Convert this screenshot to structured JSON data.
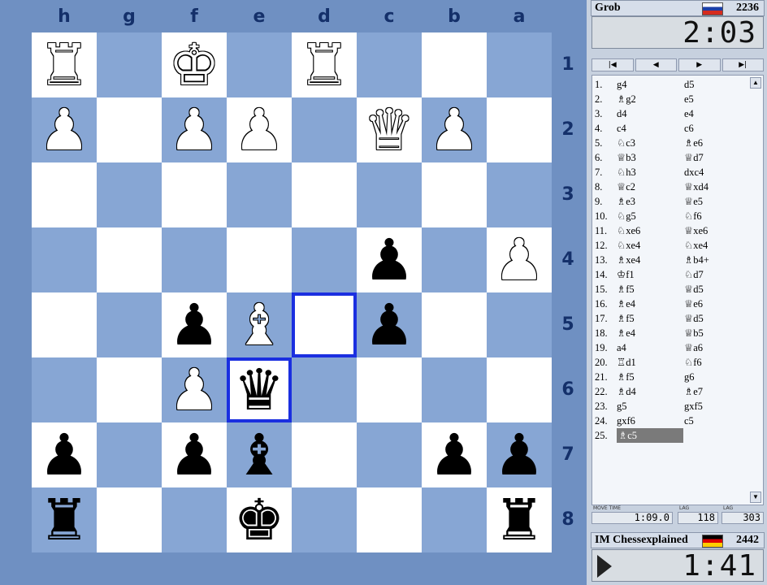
{
  "board": {
    "files": [
      "h",
      "g",
      "f",
      "e",
      "d",
      "c",
      "b",
      "a"
    ],
    "ranks": [
      "1",
      "2",
      "3",
      "4",
      "5",
      "6",
      "7",
      "8"
    ],
    "highlighted": [
      "4-4",
      "5-3"
    ],
    "pieces": [
      {
        "r": 0,
        "c": 0,
        "glyph": "♜",
        "color": "w",
        "name": "white-rook-icon"
      },
      {
        "r": 0,
        "c": 2,
        "glyph": "♚",
        "color": "w",
        "name": "white-king-icon"
      },
      {
        "r": 0,
        "c": 4,
        "glyph": "♜",
        "color": "w",
        "name": "white-rook-icon"
      },
      {
        "r": 1,
        "c": 0,
        "glyph": "♟",
        "color": "w",
        "name": "white-pawn-icon"
      },
      {
        "r": 1,
        "c": 2,
        "glyph": "♟",
        "color": "w",
        "name": "white-pawn-icon"
      },
      {
        "r": 1,
        "c": 3,
        "glyph": "♟",
        "color": "w",
        "name": "white-pawn-icon"
      },
      {
        "r": 1,
        "c": 5,
        "glyph": "♛",
        "color": "w",
        "name": "white-queen-icon"
      },
      {
        "r": 1,
        "c": 6,
        "glyph": "♟",
        "color": "w",
        "name": "white-pawn-icon"
      },
      {
        "r": 3,
        "c": 5,
        "glyph": "♟",
        "color": "b",
        "name": "black-pawn-icon"
      },
      {
        "r": 3,
        "c": 7,
        "glyph": "♟",
        "color": "w",
        "name": "white-pawn-icon"
      },
      {
        "r": 4,
        "c": 2,
        "glyph": "♟",
        "color": "b",
        "name": "black-pawn-icon"
      },
      {
        "r": 4,
        "c": 3,
        "glyph": "♝",
        "color": "w",
        "name": "white-bishop-icon"
      },
      {
        "r": 4,
        "c": 5,
        "glyph": "♟",
        "color": "b",
        "name": "black-pawn-icon"
      },
      {
        "r": 5,
        "c": 2,
        "glyph": "♟",
        "color": "w",
        "name": "white-pawn-icon"
      },
      {
        "r": 5,
        "c": 3,
        "glyph": "♛",
        "color": "b",
        "name": "black-queen-icon"
      },
      {
        "r": 6,
        "c": 0,
        "glyph": "♟",
        "color": "b",
        "name": "black-pawn-icon"
      },
      {
        "r": 6,
        "c": 2,
        "glyph": "♟",
        "color": "b",
        "name": "black-pawn-icon"
      },
      {
        "r": 6,
        "c": 3,
        "glyph": "♝",
        "color": "b",
        "name": "black-bishop-icon"
      },
      {
        "r": 6,
        "c": 6,
        "glyph": "♟",
        "color": "b",
        "name": "black-pawn-icon"
      },
      {
        "r": 6,
        "c": 7,
        "glyph": "♟",
        "color": "b",
        "name": "black-pawn-icon"
      },
      {
        "r": 7,
        "c": 0,
        "glyph": "♜",
        "color": "b",
        "name": "black-rook-icon"
      },
      {
        "r": 7,
        "c": 3,
        "glyph": "♚",
        "color": "b",
        "name": "black-king-icon"
      },
      {
        "r": 7,
        "c": 7,
        "glyph": "♜",
        "color": "b",
        "name": "black-rook-icon"
      }
    ]
  },
  "top_player": {
    "name": "Grob",
    "rating": "2236",
    "flag": "russia-flag",
    "clock": "2:03"
  },
  "bottom_player": {
    "name": "IM Chessexplained",
    "rating": "2442",
    "flag": "germany-flag",
    "clock": "1:41"
  },
  "nav": {
    "first": "|◀",
    "prev": "◀",
    "next": "▶",
    "last": "▶|"
  },
  "moves": [
    {
      "n": "1.",
      "w": "g4",
      "b": "d5"
    },
    {
      "n": "2.",
      "w": "♗g2",
      "b": "e5"
    },
    {
      "n": "3.",
      "w": "d4",
      "b": "e4"
    },
    {
      "n": "4.",
      "w": "c4",
      "b": "c6"
    },
    {
      "n": "5.",
      "w": "♘c3",
      "b": "♗e6"
    },
    {
      "n": "6.",
      "w": "♕b3",
      "b": "♕d7"
    },
    {
      "n": "7.",
      "w": "♘h3",
      "b": "dxc4"
    },
    {
      "n": "8.",
      "w": "♕c2",
      "b": "♕xd4"
    },
    {
      "n": "9.",
      "w": "♗e3",
      "b": "♕e5"
    },
    {
      "n": "10.",
      "w": "♘g5",
      "b": "♘f6"
    },
    {
      "n": "11.",
      "w": "♘xe6",
      "b": "♕xe6"
    },
    {
      "n": "12.",
      "w": "♘xe4",
      "b": "♘xe4"
    },
    {
      "n": "13.",
      "w": "♗xe4",
      "b": "♗b4+"
    },
    {
      "n": "14.",
      "w": "♔f1",
      "b": "♘d7"
    },
    {
      "n": "15.",
      "w": "♗f5",
      "b": "♕d5"
    },
    {
      "n": "16.",
      "w": "♗e4",
      "b": "♕e6"
    },
    {
      "n": "17.",
      "w": "♗f5",
      "b": "♕d5"
    },
    {
      "n": "18.",
      "w": "♗e4",
      "b": "♕b5"
    },
    {
      "n": "19.",
      "w": "a4",
      "b": "♕a6"
    },
    {
      "n": "20.",
      "w": "♖d1",
      "b": "♘f6"
    },
    {
      "n": "21.",
      "w": "♗f5",
      "b": "g6"
    },
    {
      "n": "22.",
      "w": "♗d4",
      "b": "♗e7"
    },
    {
      "n": "23.",
      "w": "g5",
      "b": "gxf5"
    },
    {
      "n": "24.",
      "w": "gxf6",
      "b": "c5"
    },
    {
      "n": "25.",
      "w": "♗c5",
      "b": ""
    }
  ],
  "stats": {
    "movetime_label": "MOVE TIME",
    "movetime": "1:09.0",
    "lag1_label": "LAG",
    "lag1": "118",
    "lag2_label": "LAG",
    "lag2": "303"
  }
}
